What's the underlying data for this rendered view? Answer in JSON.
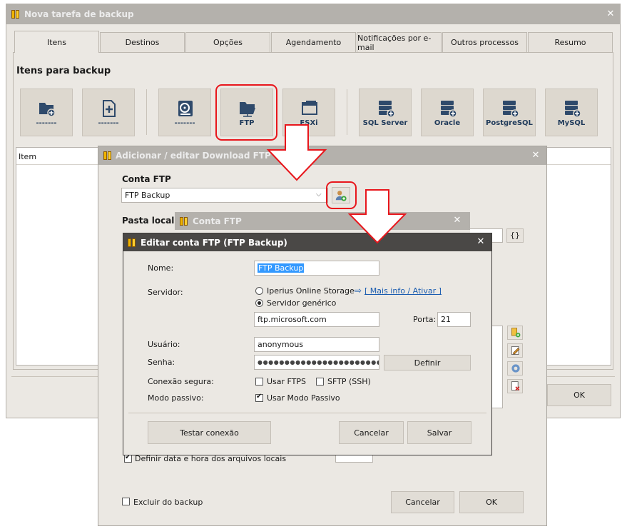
{
  "main_window": {
    "title": "Nova tarefa de backup",
    "tabs": [
      "Itens",
      "Destinos",
      "Opções",
      "Agendamento",
      "Notificações por e-mail",
      "Outros processos",
      "Resumo"
    ],
    "section_title": "Itens para backup",
    "tiles": [
      {
        "label": "-------",
        "icon": "add-folder-icon"
      },
      {
        "label": "-------",
        "icon": "add-file-icon"
      },
      {
        "label": "-------",
        "icon": "drive-image-icon"
      },
      {
        "label": "FTP",
        "icon": "ftp-folder-icon"
      },
      {
        "label": "ESXi",
        "icon": "esxi-icon"
      },
      {
        "label": "SQL Server",
        "icon": "database-icon"
      },
      {
        "label": "Oracle",
        "icon": "database-icon"
      },
      {
        "label": "PostgreSQL",
        "icon": "database-icon"
      },
      {
        "label": "MySQL",
        "icon": "database-icon"
      }
    ],
    "list_header": "Item",
    "ok_label": "OK"
  },
  "ftp_dialog": {
    "title": "Adicionar / editar Download FTP",
    "account_label": "Conta FTP",
    "account_value": "FTP Backup",
    "local_folder_label": "Pasta local pa",
    "braces_label": "{}",
    "date_checkbox_label": "Definir data e hora dos arquivos locais",
    "exclude_label": "Excluir do backup",
    "cancel_label": "Cancelar",
    "ok_label": "OK"
  },
  "account_dialog": {
    "title": "Conta FTP"
  },
  "edit_dialog": {
    "title": "Editar conta FTP (FTP Backup)",
    "name_label": "Nome:",
    "name_value": "FTP Backup",
    "server_label": "Servidor:",
    "radio_online": "Iperius Online Storage",
    "more_info_link": "[ Mais info / Ativar ]",
    "radio_generic": "Servidor genérico",
    "server_value": "ftp.microsoft.com",
    "port_label": "Porta:",
    "port_value": "21",
    "user_label": "Usuário:",
    "user_value": "anonymous",
    "password_label": "Senha:",
    "password_value": "●●●●●●●●●●●●●●●●●●●●●●●●●",
    "define_label": "Definir",
    "secure_label": "Conexão segura:",
    "ftps_label": "Usar FTPS",
    "sftp_label": "SFTP (SSH)",
    "passive_label": "Modo passivo:",
    "passive_check_label": "Usar Modo Passivo",
    "test_label": "Testar conexão",
    "cancel_label": "Cancelar",
    "save_label": "Salvar"
  },
  "colors": {
    "title_inactive": "#b4b1ac",
    "title_active": "#4a4846",
    "window_bg": "#ebe8e3",
    "highlight": "#e8161c",
    "link": "#1a5cb0"
  }
}
